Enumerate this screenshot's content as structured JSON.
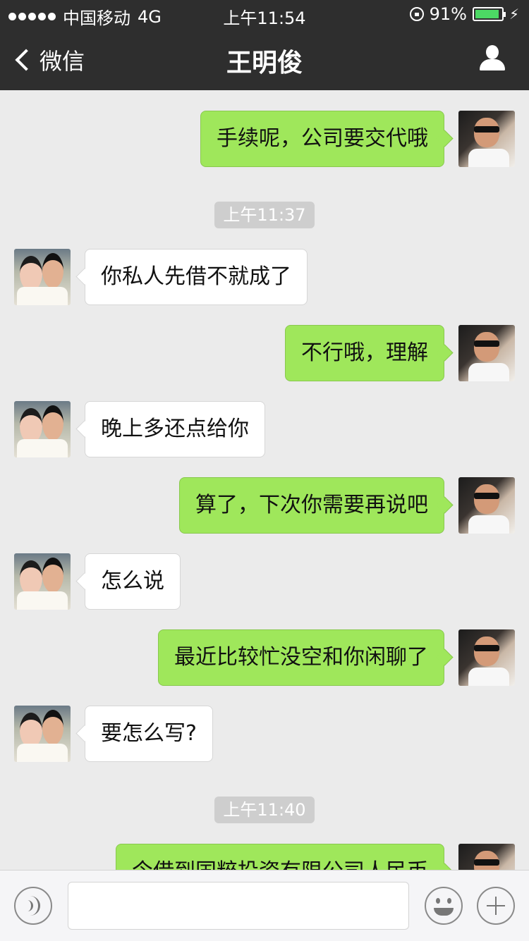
{
  "status": {
    "carrier": "中国移动",
    "network": "4G",
    "time": "上午11:54",
    "battery_percent": "91%"
  },
  "header": {
    "back_label": "微信",
    "title": "王明俊"
  },
  "timestamps": [
    "上午11:37",
    "上午11:40"
  ],
  "messages": [
    {
      "side": "out",
      "text": "手续呢，公司要交代哦"
    },
    {
      "side": "in",
      "text": "你私人先借不就成了"
    },
    {
      "side": "out",
      "text": "不行哦，理解"
    },
    {
      "side": "in",
      "text": "晚上多还点给你"
    },
    {
      "side": "out",
      "text": "算了，下次你需要再说吧"
    },
    {
      "side": "in",
      "text": "怎么说"
    },
    {
      "side": "out",
      "text": "最近比较忙没空和你闲聊了"
    },
    {
      "side": "in",
      "text": "要怎么写?"
    },
    {
      "side": "out",
      "text": "今借到国粹投资有限公司人民币"
    }
  ],
  "colors": {
    "bar": "#2e2e2e",
    "outgoing": "#9fe75b",
    "incoming": "#ffffff",
    "background": "#ebebeb"
  }
}
